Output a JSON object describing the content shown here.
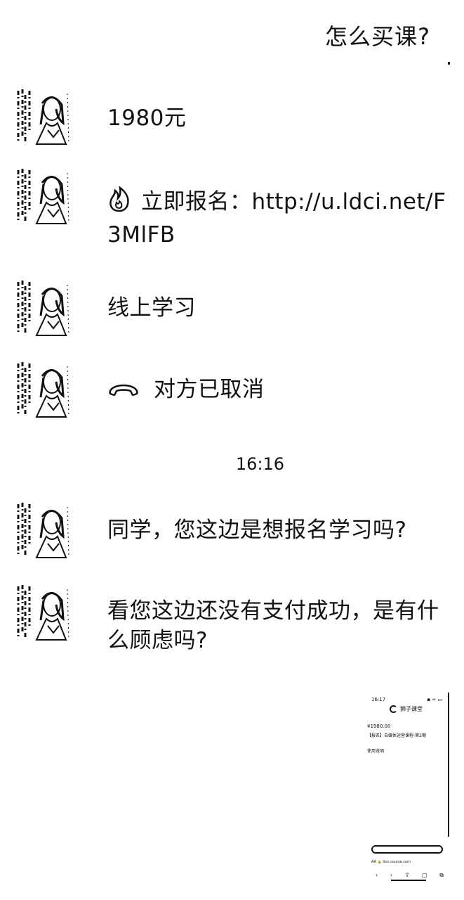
{
  "chat": {
    "outgoing": [
      {
        "text": "怎么买课?"
      }
    ],
    "incoming": [
      {
        "text": "1980元"
      },
      {
        "icon": "fire-icon",
        "text": "立即报名：http://u.ldci.net/F3MlFB"
      },
      {
        "text": "线上学习"
      },
      {
        "icon": "phone-hangup-icon",
        "text": "对方已取消"
      },
      {
        "text": "同学，您这边是想报名学习吗?"
      },
      {
        "text": "看您这边还没有支付成功，是有什么顾虑吗?"
      }
    ],
    "timestamp": "16:16"
  },
  "screenshot_bubble": {
    "status_time": "16:17",
    "status_icons": "▪ ≈ ▭",
    "brand": "狮子课堂",
    "price": "¥1980.00",
    "title": "【报名】自媒体运营课程-第2期",
    "link": "使用说明",
    "url_text": "AA  🔒 lion.course.com",
    "nav": [
      "‹",
      "›",
      "⇪",
      "▢",
      "⧉"
    ]
  },
  "colors": {
    "background": "#ffffff",
    "text": "#111111"
  }
}
